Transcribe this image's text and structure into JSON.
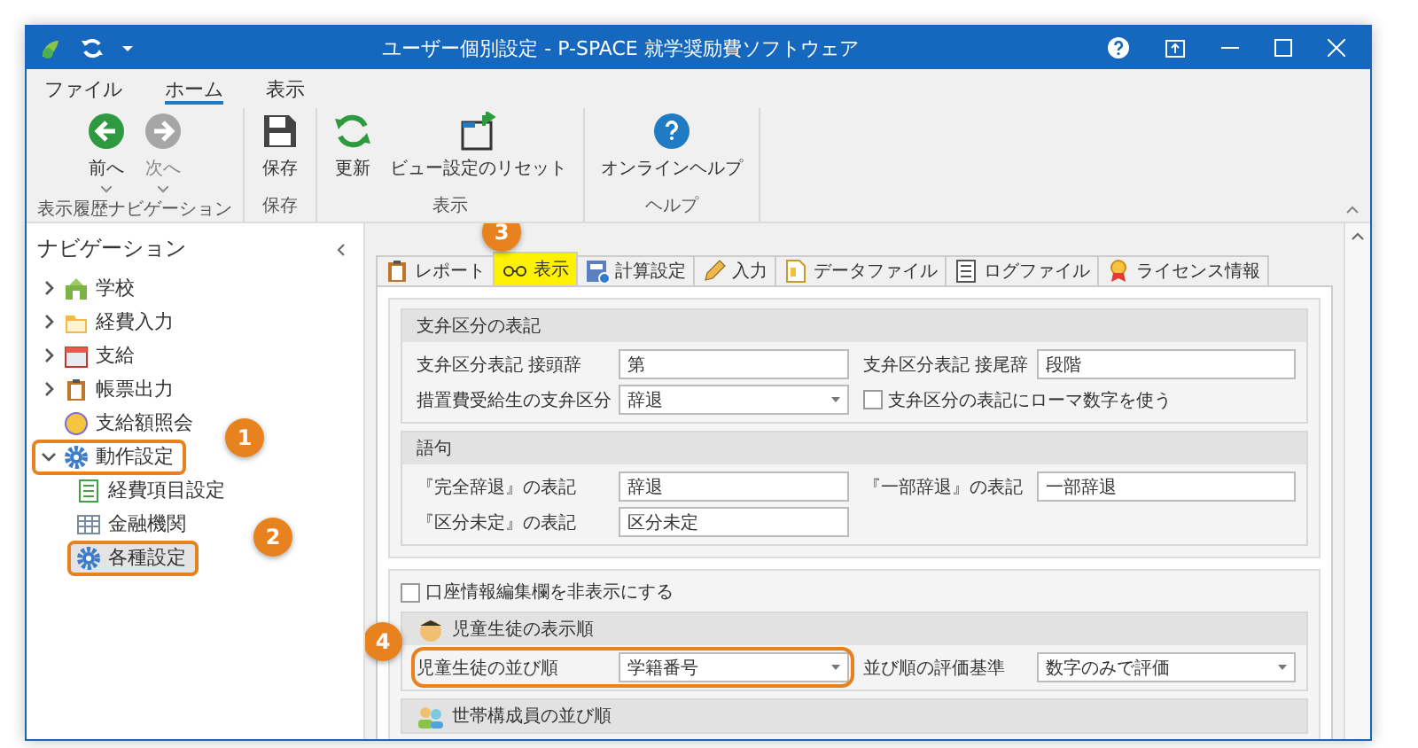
{
  "window": {
    "title": "ユーザー個別設定 - P-SPACE 就学奨励費ソフトウェア"
  },
  "ribbon": {
    "tabs": [
      {
        "label": "ファイル",
        "selected": false
      },
      {
        "label": "ホーム",
        "selected": true
      },
      {
        "label": "表示",
        "selected": false
      }
    ],
    "groups": [
      {
        "label": "表示履歴ナビゲーション",
        "buttons": [
          {
            "label": "前へ",
            "disabled": false,
            "dropdown": true
          },
          {
            "label": "次へ",
            "disabled": true,
            "dropdown": true
          }
        ]
      },
      {
        "label": "保存",
        "buttons": [
          {
            "label": "保存",
            "disabled": false,
            "dropdown": false
          }
        ]
      },
      {
        "label": "表示",
        "buttons": [
          {
            "label": "更新",
            "disabled": false,
            "dropdown": false
          },
          {
            "label": "ビュー設定のリセット",
            "disabled": false,
            "dropdown": false
          }
        ]
      },
      {
        "label": "ヘルプ",
        "buttons": [
          {
            "label": "オンラインヘルプ",
            "disabled": false,
            "dropdown": false
          }
        ]
      }
    ]
  },
  "navigation": {
    "title": "ナビゲーション",
    "items": [
      {
        "label": "学校",
        "expanded": false,
        "selected": false
      },
      {
        "label": "経費入力",
        "expanded": false,
        "selected": false
      },
      {
        "label": "支給",
        "expanded": false,
        "selected": false
      },
      {
        "label": "帳票出力",
        "expanded": false,
        "selected": false
      },
      {
        "label": "支給額照会",
        "selected": false
      },
      {
        "label": "動作設定",
        "expanded": true,
        "selected": false,
        "callout": "1",
        "children": [
          {
            "label": "経費項目設定",
            "selected": false
          },
          {
            "label": "金融機関",
            "selected": false
          },
          {
            "label": "各種設定",
            "selected": true,
            "callout": "2"
          }
        ]
      }
    ]
  },
  "settings": {
    "tabs": [
      {
        "label": "レポート",
        "selected": false
      },
      {
        "label": "表示",
        "selected": true,
        "callout": "3"
      },
      {
        "label": "計算設定",
        "selected": false
      },
      {
        "label": "入力",
        "selected": false
      },
      {
        "label": "データファイル",
        "selected": false
      },
      {
        "label": "ログファイル",
        "selected": false
      },
      {
        "label": "ライセンス情報",
        "selected": false
      }
    ],
    "panels": [
      {
        "items": [
          {
            "kind": "group",
            "title": "支弁区分の表記",
            "rows": [
              [
                {
                  "kind": "text",
                  "label": "支弁区分表記 接頭辞",
                  "value": "第"
                },
                {
                  "kind": "text",
                  "label": "支弁区分表記 接尾辞",
                  "value": "段階"
                }
              ],
              [
                {
                  "kind": "select",
                  "label": "措置費受給生の支弁区分",
                  "value": "辞退"
                },
                {
                  "kind": "checkbox",
                  "label": "支弁区分の表記にローマ数字を使う",
                  "checked": false
                }
              ]
            ]
          },
          {
            "kind": "group",
            "title": "語句",
            "rows": [
              [
                {
                  "kind": "text",
                  "label": "『完全辞退』の表記",
                  "value": "辞退"
                },
                {
                  "kind": "text",
                  "label": "『一部辞退』の表記",
                  "value": "一部辞退"
                }
              ],
              [
                {
                  "kind": "text",
                  "label": "『区分未定』の表記",
                  "value": "区分未定"
                }
              ]
            ]
          }
        ]
      },
      {
        "items": [
          {
            "kind": "checkbox",
            "label": "口座情報編集欄を非表示にする",
            "checked": false
          },
          {
            "kind": "group",
            "title": "児童生徒の表示順",
            "rows": [
              [
                {
                  "kind": "select",
                  "label": "児童生徒の並び順",
                  "value": "学籍番号",
                  "callout": "4"
                },
                {
                  "kind": "select",
                  "label": "並び順の評価基準",
                  "value": "数字のみで評価"
                }
              ]
            ]
          },
          {
            "kind": "group",
            "title": "世帯構成員の並び順"
          }
        ]
      }
    ]
  }
}
